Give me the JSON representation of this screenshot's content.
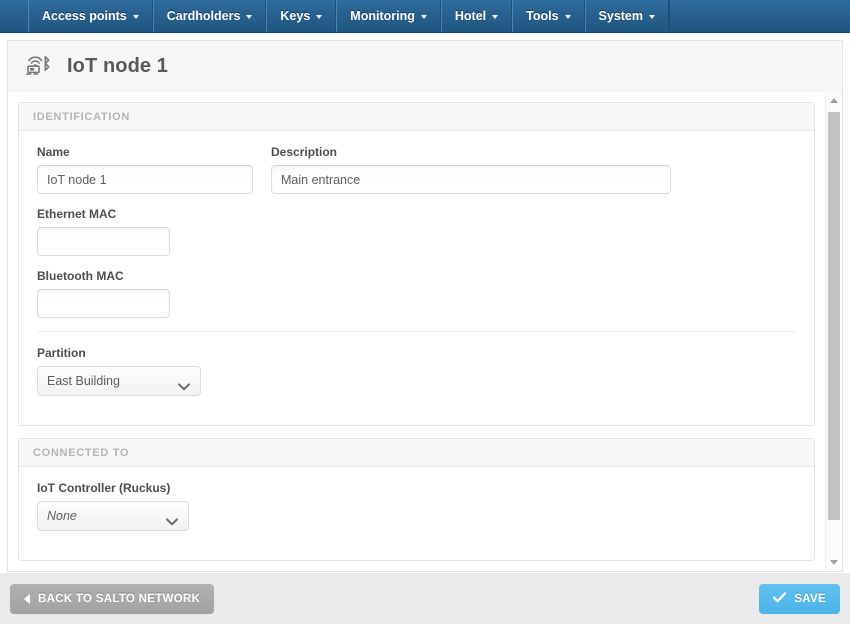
{
  "navbar": {
    "items": [
      {
        "label": "Access points",
        "icon": "chevron-down-icon"
      },
      {
        "label": "Cardholders",
        "icon": "chevron-down-icon"
      },
      {
        "label": "Keys",
        "icon": "chevron-down-icon"
      },
      {
        "label": "Monitoring",
        "icon": "chevron-down-icon"
      },
      {
        "label": "Hotel",
        "icon": "chevron-down-icon"
      },
      {
        "label": "Tools",
        "icon": "chevron-down-icon"
      },
      {
        "label": "System",
        "icon": "chevron-down-icon"
      }
    ],
    "background_color": "#28618f",
    "text_color": "#ffffff"
  },
  "header": {
    "title": "IoT node 1",
    "icon": "iot-node-icon"
  },
  "sections": {
    "identification": {
      "title": "IDENTIFICATION",
      "fields": {
        "name": {
          "label": "Name",
          "value": "IoT node 1",
          "placeholder": ""
        },
        "description": {
          "label": "Description",
          "value": "Main entrance",
          "placeholder": ""
        },
        "ethernet_mac": {
          "label": "Ethernet MAC",
          "value": "",
          "placeholder": ""
        },
        "bluetooth_mac": {
          "label": "Bluetooth MAC",
          "value": "",
          "placeholder": ""
        },
        "partition": {
          "label": "Partition",
          "value": "East Building",
          "options": [
            "East Building"
          ]
        }
      }
    },
    "connected_to": {
      "title": "CONNECTED TO",
      "fields": {
        "iot_controller": {
          "label": "IoT Controller (Ruckus)",
          "value": "None",
          "options": [
            "None"
          ]
        }
      }
    }
  },
  "scrollbar": {
    "up_icon": "scroll-up-arrow-icon",
    "down_icon": "scroll-down-arrow-icon"
  },
  "footer": {
    "back_label": "BACK TO SALTO NETWORK",
    "back_icon": "chevron-left-icon",
    "save_label": "SAVE",
    "save_icon": "check-icon",
    "save_color": "#4ab3e8",
    "back_color": "#a2a2a2"
  }
}
